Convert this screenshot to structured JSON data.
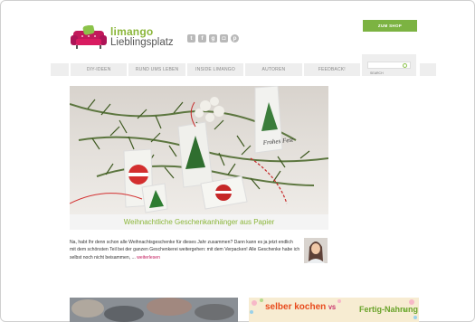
{
  "brand": {
    "name": "limango",
    "subtitle": "Lieblingsplatz"
  },
  "social": [
    "twitter-icon",
    "facebook-icon",
    "google-plus-icon",
    "instagram-icon",
    "pinterest-icon"
  ],
  "shop_button": "ZUM SHOP",
  "nav": {
    "items": [
      "DIY-IDEEN",
      "RUND UMS LEBEN",
      "INSIDE LIMANGO",
      "AUTOREN",
      "FEEDBACK!"
    ],
    "search_placeholder": "SEARCH"
  },
  "hero_tag_text": "Frohes Fest",
  "post": {
    "title": "Weihnachtliche Geschenkanhänger aus Papier",
    "excerpt": "Na, habt Ihr denn schon alle Weihnachtsgeschenke für dieses Jahr zusammen? Dann kann es ja jetzt endlich mit dem schönsten Teil bei der ganzen Geschenkerei weitergehen: mit dem Verpacken! Alle Geschenke habe ich selbst noch nicht beisammen, ...",
    "read_more": "weiterlesen"
  },
  "teaser_right": {
    "main": "selber kochen",
    "vs": "VS",
    "sub": "Fertig-Nahrung"
  },
  "colors": {
    "accent_green": "#8bb63a",
    "shop_green": "#7cb342",
    "link_pink": "#c2185b",
    "nav_bg": "#eeeeee"
  }
}
